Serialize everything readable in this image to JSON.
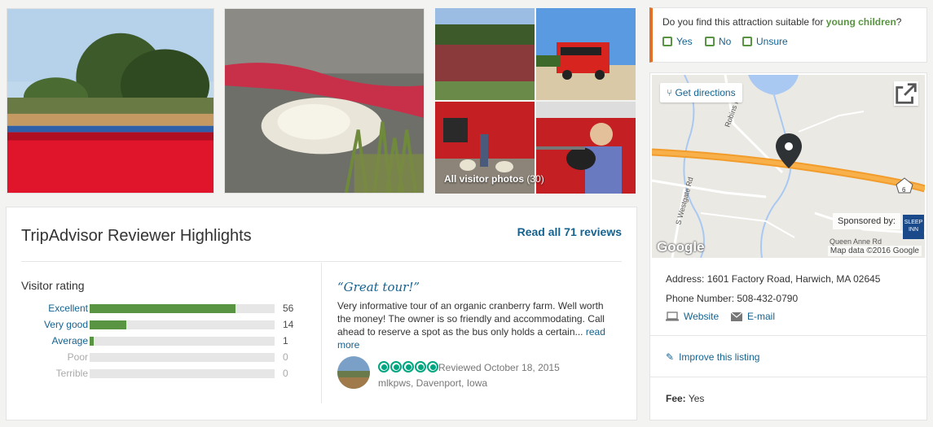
{
  "photos": {
    "all_label": "All visitor photos",
    "all_count": "(30)"
  },
  "highlights": {
    "title": "TripAdvisor Reviewer Highlights",
    "read_all": "Read all 71 reviews",
    "visitor_rating_title": "Visitor rating",
    "ratings": [
      {
        "label": "Excellent",
        "count": "56",
        "fraction": 0.79,
        "active": true
      },
      {
        "label": "Very good",
        "count": "14",
        "fraction": 0.2,
        "active": true
      },
      {
        "label": "Average",
        "count": "1",
        "fraction": 0.02,
        "active": true
      },
      {
        "label": "Poor",
        "count": "0",
        "fraction": 0,
        "active": false
      },
      {
        "label": "Terrible",
        "count": "0",
        "fraction": 0,
        "active": false
      }
    ],
    "review": {
      "quote": "“Great tour!”",
      "text": "Very informative tour of an organic cranberry farm. Well worth the money! The owner is so friendly and accommodating. Call ahead to reserve a spot as the bus only holds a certain...",
      "read_more": "read more",
      "bubble_rating": 5,
      "reviewed": "Reviewed October 18, 2015",
      "reviewer": "mlkpws, Davenport, Iowa"
    }
  },
  "suitability": {
    "question_prefix": "Do you find this attraction suitable for",
    "question_keyword": "young children",
    "question_suffix": "?",
    "options": [
      "Yes",
      "No",
      "Unsure"
    ]
  },
  "location": {
    "get_directions": "Get directions",
    "sponsored_by": "Sponsored by:",
    "sponsor_logo": "SLEEP INN",
    "map_data": "Map data ©2016 Google",
    "google": "Google",
    "roads": [
      "Robins Rd",
      "S Westgate Rd",
      "Queen Anne Rd",
      "6"
    ],
    "address": "Address: 1601 Factory Road, Harwich, MA 02645",
    "phone": "Phone Number: 508-432-0790",
    "website": "Website",
    "email": "E-mail",
    "improve": "Improve this listing",
    "fee_label": "Fee:",
    "fee_value": "Yes"
  },
  "colors": {
    "brand_link": "#16628f",
    "rating_green": "#589442",
    "bubble_green": "#00a680",
    "accent_orange": "#e07126"
  }
}
